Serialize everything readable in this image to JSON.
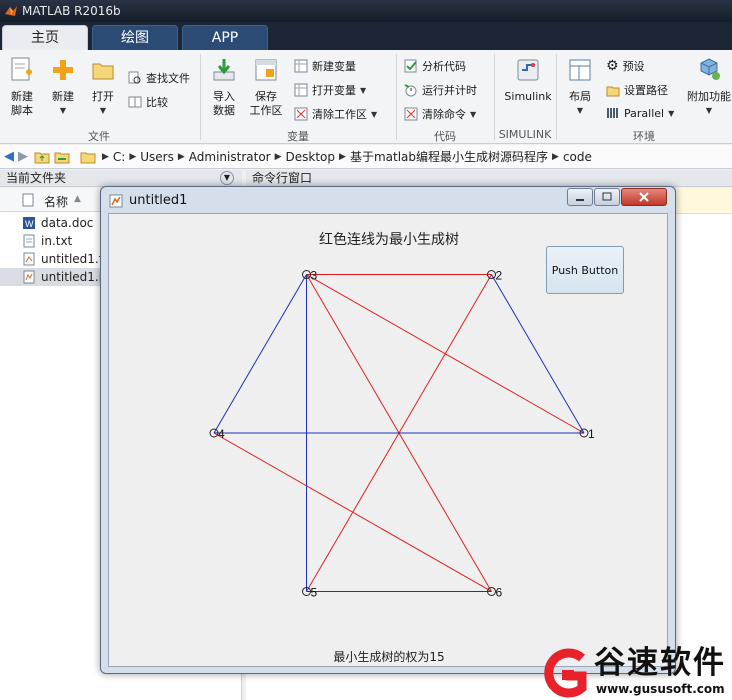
{
  "app": {
    "title": "MATLAB R2016b"
  },
  "tabs": [
    {
      "label": "主页"
    },
    {
      "label": "绘图"
    },
    {
      "label": "APP"
    }
  ],
  "ribbon": {
    "file": {
      "new_script": "新建\n脚本",
      "new": "新建",
      "open": "打开",
      "find_files": "查找文件",
      "compare": "比较",
      "group": "文件"
    },
    "variable": {
      "import": "导入\n数据",
      "save": "保存\n工作区",
      "new_var": "新建变量",
      "open_var": "打开变量",
      "clear_ws": "清除工作区",
      "group": "变量"
    },
    "code": {
      "analyze": "分析代码",
      "run_time": "运行并计时",
      "clear_cmd": "清除命令",
      "group": "代码"
    },
    "simulink": {
      "label": "Simulink",
      "group": "SIMULINK"
    },
    "env": {
      "layout": "布局",
      "prefs": "预设",
      "set_path": "设置路径",
      "parallel": "Parallel",
      "addons": "附加功能",
      "group": "环境"
    }
  },
  "address": {
    "crumbs": [
      "C:",
      "Users",
      "Administrator",
      "Desktop",
      "基于matlab编程最小生成树源码程序",
      "code"
    ]
  },
  "current_folder": {
    "title": "当前文件夹",
    "column_name": "名称",
    "files": [
      {
        "name": "data.doc",
        "icon": "word-doc-icon"
      },
      {
        "name": "in.txt",
        "icon": "text-file-icon"
      },
      {
        "name": "untitled1.fi",
        "icon": "fig-file-icon"
      },
      {
        "name": "untitled1.m",
        "icon": "m-file-icon"
      }
    ]
  },
  "command_window": {
    "title": "命令行窗口"
  },
  "figure": {
    "title": "untitled1",
    "push_button": "Push Button",
    "axis_title": "红色连线为最小生成树",
    "weight_text": "最小生成树的权为15"
  },
  "chart_data": {
    "type": "graph",
    "title": "红色连线为最小生成树",
    "nodes": [
      {
        "id": "1",
        "x": 1.0,
        "y": 0.0
      },
      {
        "id": "2",
        "x": 0.5,
        "y": 0.866
      },
      {
        "id": "3",
        "x": -0.5,
        "y": 0.866
      },
      {
        "id": "4",
        "x": -1.0,
        "y": 0.0
      },
      {
        "id": "5",
        "x": -0.5,
        "y": -0.866
      },
      {
        "id": "6",
        "x": 0.5,
        "y": -0.866
      }
    ],
    "edges": [
      {
        "from": "3",
        "to": "2",
        "color": "#e02020"
      },
      {
        "from": "3",
        "to": "1",
        "color": "#e02020"
      },
      {
        "from": "3",
        "to": "6",
        "color": "#e02020"
      },
      {
        "from": "2",
        "to": "5",
        "color": "#e02020"
      },
      {
        "from": "4",
        "to": "6",
        "color": "#e02020"
      },
      {
        "from": "3",
        "to": "4",
        "color": "#1f2fbf"
      },
      {
        "from": "3",
        "to": "5",
        "color": "#1f2fbf"
      },
      {
        "from": "2",
        "to": "1",
        "color": "#1f2fbf"
      },
      {
        "from": "4",
        "to": "1",
        "color": "#1f2fbf"
      },
      {
        "from": "5",
        "to": "6",
        "color": "#1f2fbf"
      }
    ]
  },
  "watermark": {
    "name": "谷速软件",
    "url": "www.gususoft.com",
    "brand_color": "#e8222a"
  }
}
